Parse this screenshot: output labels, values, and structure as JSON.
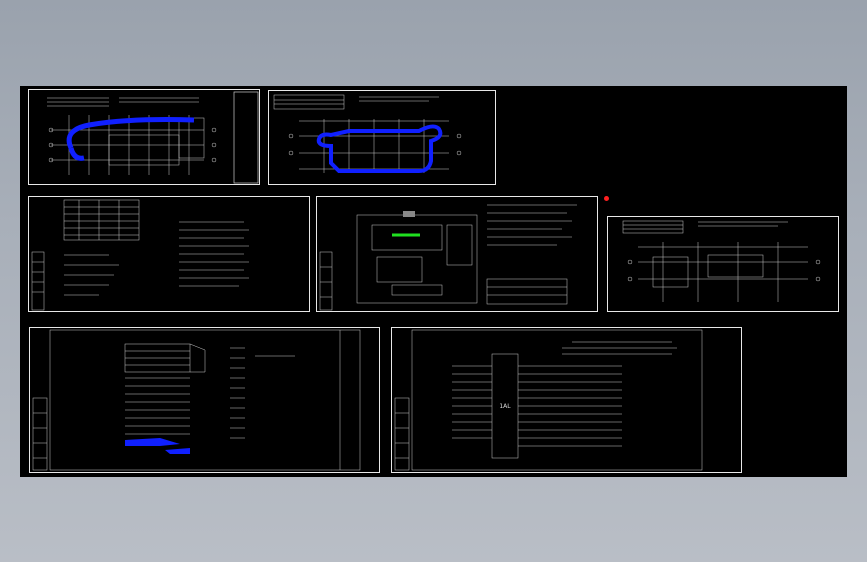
{
  "viewport": {
    "background": "#000000",
    "desktop_color": "#a4abb5"
  },
  "colors": {
    "frame": "#e6e6e6",
    "line": "#cfcfcf",
    "highlight_blue": "#1020ff",
    "highlight_green": "#20e020",
    "marker_red": "#ff2020"
  },
  "sheets": [
    {
      "id": "sheet-1",
      "kind": "floor-plan-wing"
    },
    {
      "id": "sheet-2",
      "kind": "floor-plan-loop"
    },
    {
      "id": "sheet-3",
      "kind": "legend-table"
    },
    {
      "id": "sheet-4",
      "kind": "site-plan"
    },
    {
      "id": "sheet-5",
      "kind": "floor-plan-small"
    },
    {
      "id": "sheet-6",
      "kind": "distribution-board"
    },
    {
      "id": "sheet-7",
      "kind": "single-line-diagram",
      "board_label": "1AL"
    }
  ]
}
